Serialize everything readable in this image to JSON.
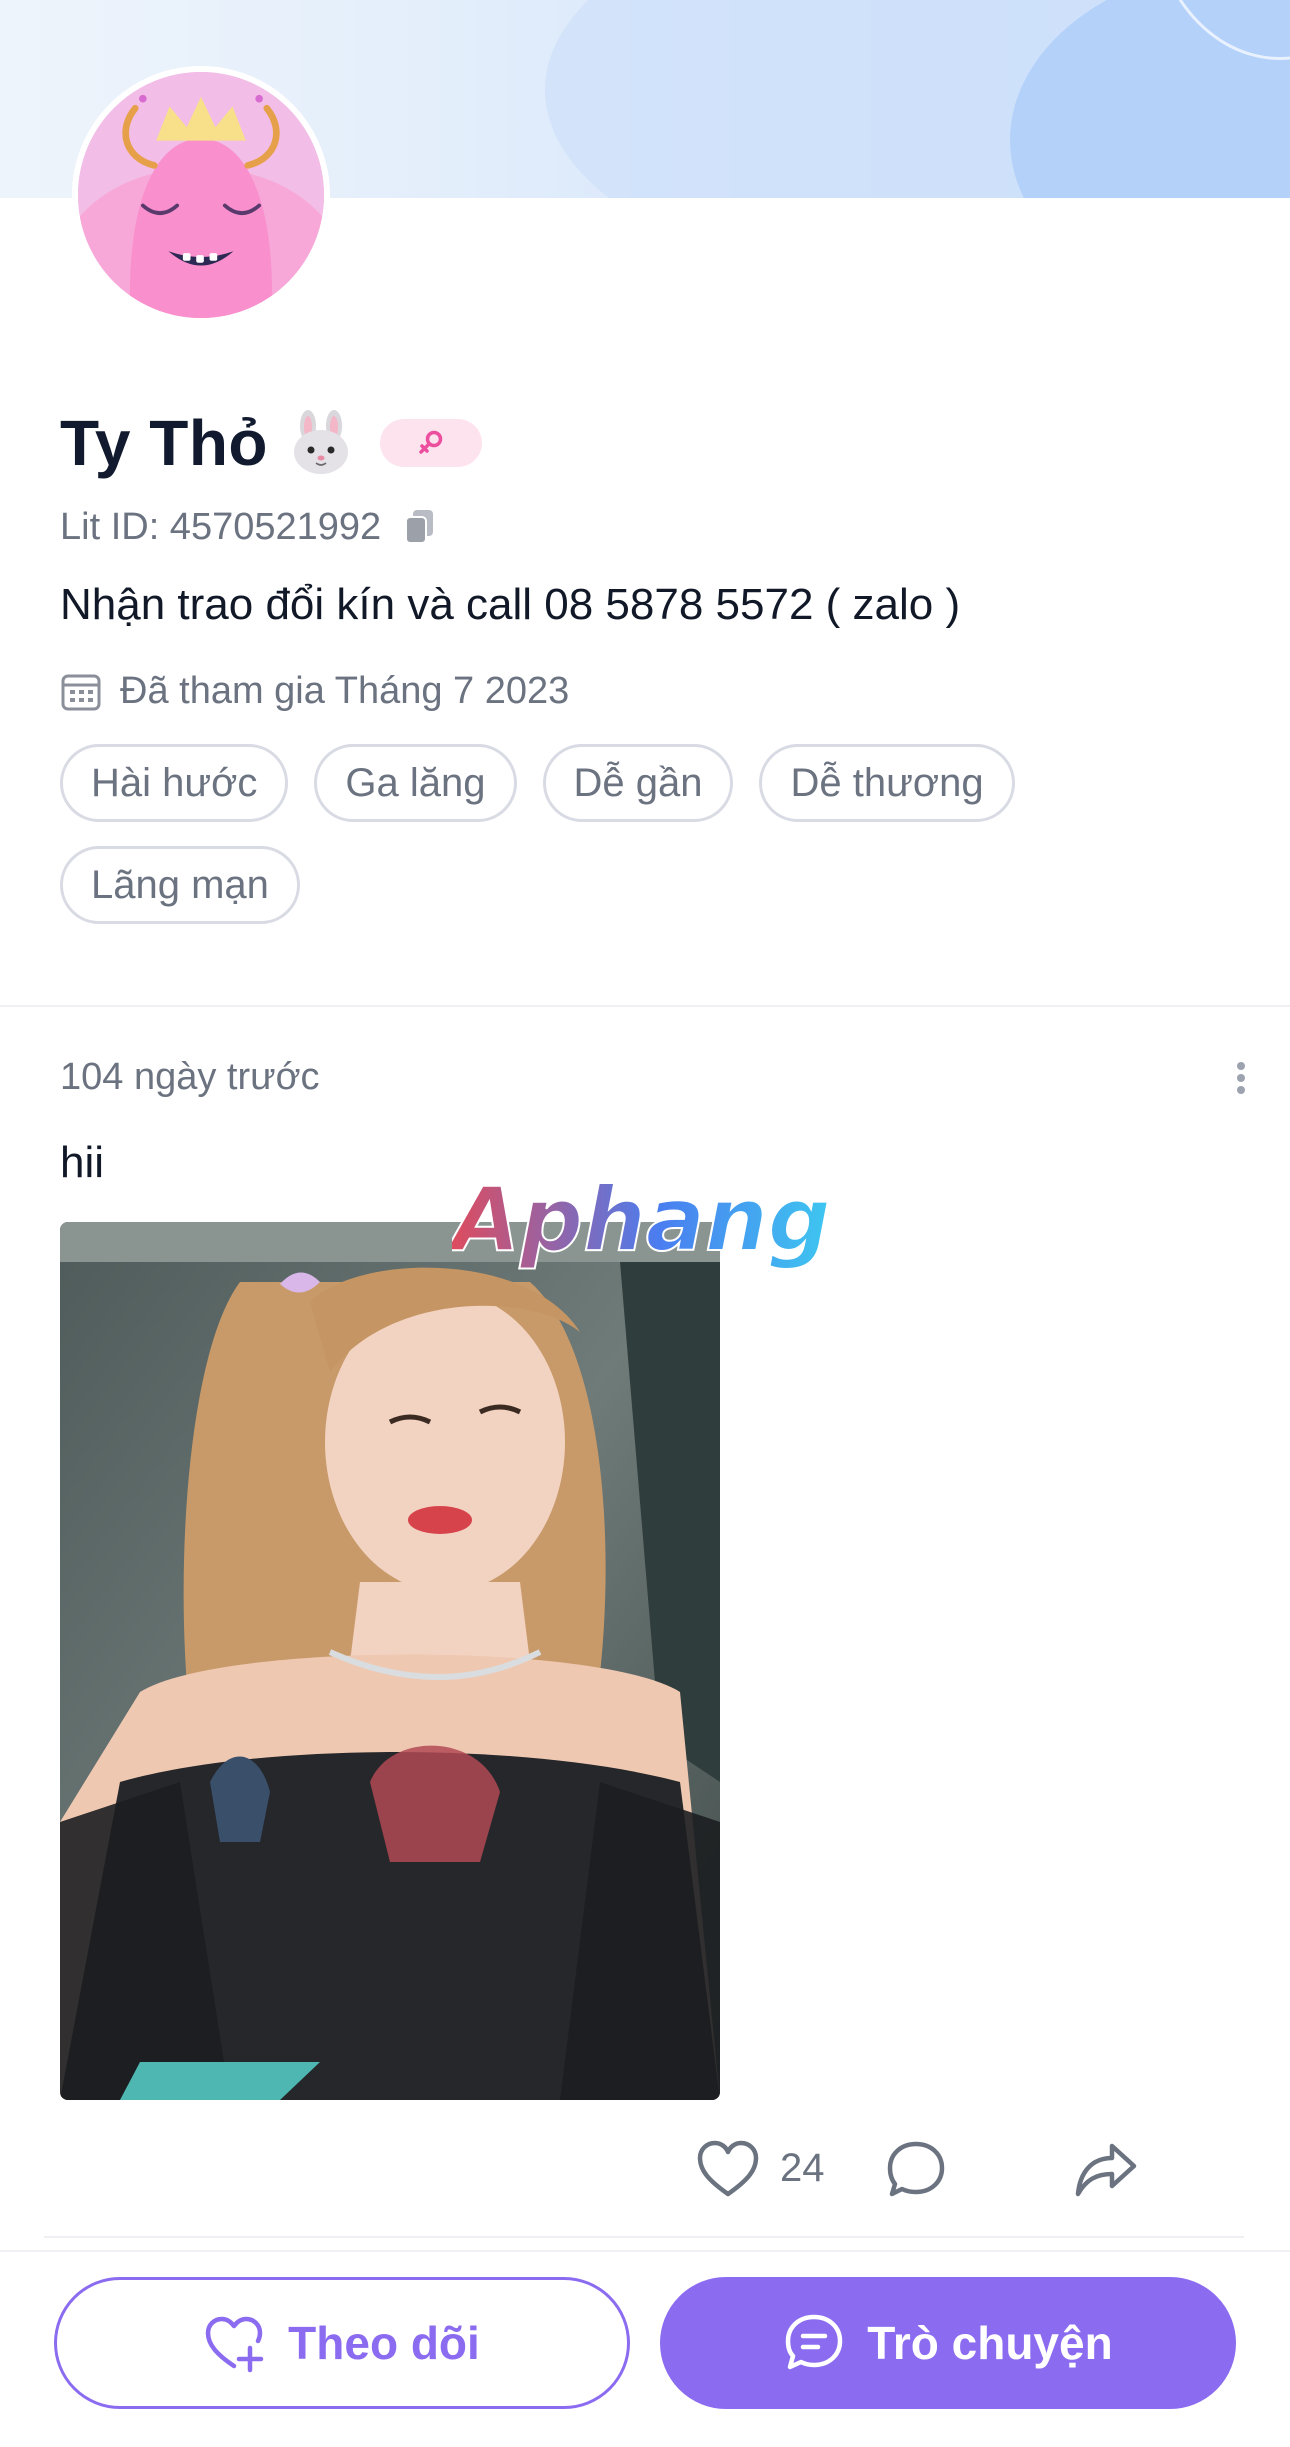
{
  "profile": {
    "name": "Ty Thỏ",
    "name_emoji_icon": "rabbit-face-icon",
    "gender_icon": "female-symbol-icon",
    "lit_id_label": "Lit ID: 4570521992",
    "bio": "Nhận trao đổi kín và call 08 5878 5572 ( zalo )",
    "joined": "Đã tham gia Tháng 7 2023",
    "tags": [
      "Hài hước",
      "Ga lăng",
      "Dễ gần",
      "Dễ thương",
      "Lãng mạn"
    ]
  },
  "post": {
    "time": "104 ngày trước",
    "text": "hii",
    "likes": "24"
  },
  "watermark": {
    "text": "Aphang"
  },
  "actions": {
    "follow_label": "Theo dõi",
    "chat_label": "Trò chuyện"
  },
  "colors": {
    "accent": "#8b6cf0",
    "muted_text": "#6b7280",
    "badge_pink": "#fde3ee"
  }
}
